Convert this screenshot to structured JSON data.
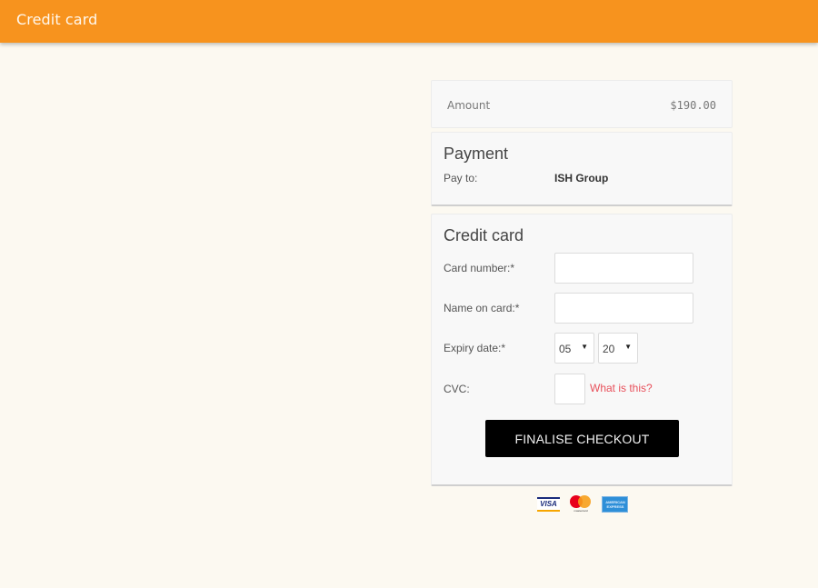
{
  "header": {
    "title": "Credit card",
    "color": "#f7931e"
  },
  "summary": {
    "amount_label": "Amount",
    "amount_value": "$190.00"
  },
  "payment": {
    "heading": "Payment",
    "pay_to_label": "Pay to:",
    "pay_to_value": "ISH Group"
  },
  "credit_card": {
    "heading": "Credit card",
    "card_number_label": "Card number:*",
    "card_number_value": "",
    "name_label": "Name on card:*",
    "name_value": "",
    "expiry_label": "Expiry date:*",
    "expiry_month": "05",
    "expiry_year": "20",
    "cvc_label": "CVC:",
    "cvc_value": "",
    "cvc_help_link": "What is this?",
    "submit_label": "FINALISE CHECKOUT"
  },
  "accepted_cards": [
    {
      "name": "visa",
      "label": "VISA"
    },
    {
      "name": "mastercard",
      "label": "mastercard"
    },
    {
      "name": "amex",
      "label": "AMERICAN EXPRESS"
    }
  ]
}
